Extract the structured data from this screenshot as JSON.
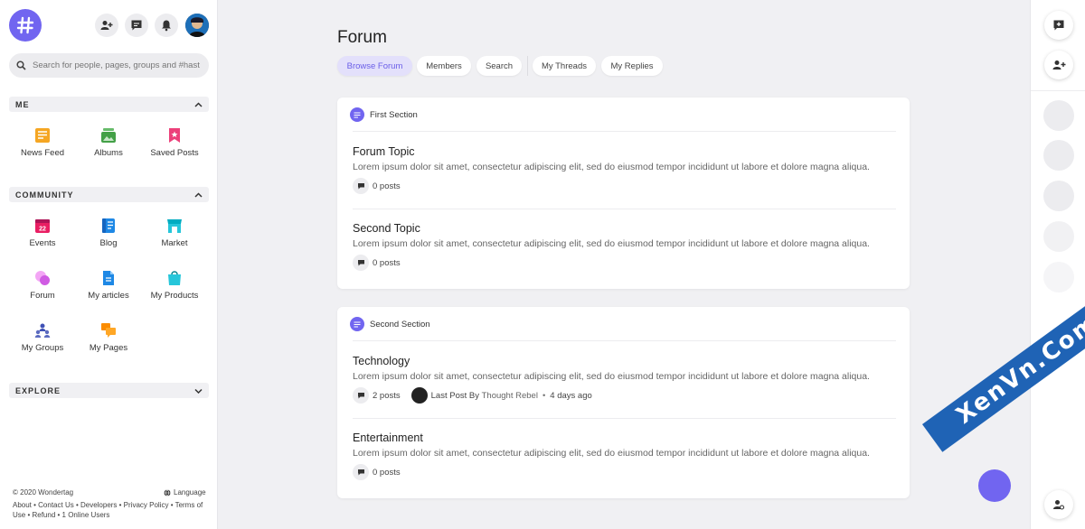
{
  "search": {
    "placeholder": "Search for people, pages, groups and #hast"
  },
  "sidebar": {
    "sections": {
      "me": "ME",
      "community": "COMMUNITY",
      "explore": "EXPLORE"
    },
    "me_items": [
      {
        "label": "News Feed",
        "icon": "news-feed-icon",
        "color": "#f5a623"
      },
      {
        "label": "Albums",
        "icon": "albums-icon",
        "color": "#43a047"
      },
      {
        "label": "Saved Posts",
        "icon": "saved-posts-icon",
        "color": "#ec407a"
      }
    ],
    "community_items": [
      {
        "label": "Events",
        "icon": "events-icon",
        "color": "#e91e63"
      },
      {
        "label": "Blog",
        "icon": "blog-icon",
        "color": "#1e88e5"
      },
      {
        "label": "Market",
        "icon": "market-icon",
        "color": "#26c6da"
      },
      {
        "label": "Forum",
        "icon": "forum-icon",
        "color": "#d05ce3"
      },
      {
        "label": "My articles",
        "icon": "articles-icon",
        "color": "#1e88e5"
      },
      {
        "label": "My Products",
        "icon": "products-icon",
        "color": "#26c6da"
      },
      {
        "label": "My Groups",
        "icon": "groups-icon",
        "color": "#3f51b5"
      },
      {
        "label": "My Pages",
        "icon": "pages-icon",
        "color": "#fb8c00"
      }
    ],
    "footer": {
      "copyright": "© 2020 Wondertag",
      "language": "Language",
      "links": "About • Contact Us • Developers • Privacy Policy • Terms of Use • Refund • 1 Online Users"
    }
  },
  "main": {
    "title": "Forum",
    "tabs": [
      "Browse Forum",
      "Members",
      "Search",
      "My Threads",
      "My Replies"
    ],
    "sections": [
      {
        "name": "First Section",
        "topics": [
          {
            "title": "Forum Topic",
            "desc": "Lorem ipsum dolor sit amet, consectetur adipiscing elit, sed do eiusmod tempor incididunt ut labore et dolore magna aliqua.",
            "posts": "0 posts"
          },
          {
            "title": "Second Topic",
            "desc": "Lorem ipsum dolor sit amet, consectetur adipiscing elit, sed do eiusmod tempor incididunt ut labore et dolore magna aliqua.",
            "posts": "0 posts"
          }
        ]
      },
      {
        "name": "Second Section",
        "topics": [
          {
            "title": "Technology",
            "desc": "Lorem ipsum dolor sit amet, consectetur adipiscing elit, sed do eiusmod tempor incididunt ut labore et dolore magna aliqua.",
            "posts": "2 posts",
            "last_post_prefix": "Last Post By",
            "last_post_user": "Thought Rebel",
            "last_post_time": "4 days ago"
          },
          {
            "title": "Entertainment",
            "desc": "Lorem ipsum dolor sit amet, consectetur adipiscing elit, sed do eiusmod tempor incididunt ut labore et dolore magna aliqua.",
            "posts": "0 posts"
          }
        ]
      }
    ]
  },
  "watermark": "XenVn.Com",
  "colors": {
    "accent": "#7165f0",
    "accent_soft": "#e3e0fb",
    "banner": "#1f63b5"
  }
}
